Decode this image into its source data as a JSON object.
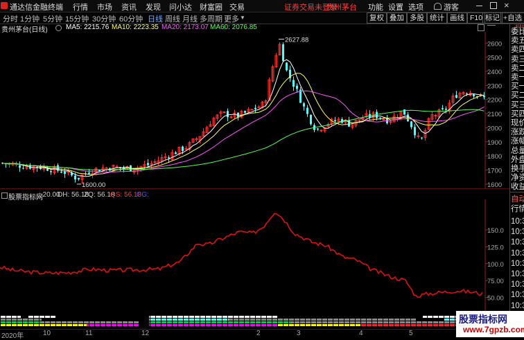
{
  "titlebar": {
    "app_name": "通达信金融终端",
    "menus": [
      "行情",
      "市场",
      "资讯",
      "发现",
      "问小达",
      "财富圈",
      "交易"
    ],
    "notice": "证券交易未登录",
    "stock_tab": "贵州茅台",
    "right_menus": [
      "功能",
      "设置",
      "选项"
    ],
    "user": "游客",
    "window_controls": [
      "minimize-icon",
      "maximize-icon",
      "close-icon"
    ]
  },
  "toolbar": {
    "periods": [
      "分时",
      "1分钟",
      "5分钟",
      "15分钟",
      "30分钟",
      "60分钟",
      "日线",
      "周线",
      "月线",
      "多周期",
      "更多"
    ],
    "selected_period": "日线",
    "buttons": [
      "复权",
      "叠加",
      "多股",
      "统计",
      "画线",
      "F10",
      "标记",
      "+自选"
    ]
  },
  "main_chart": {
    "stock_label": "贵州茅台(日线)",
    "ma": [
      {
        "label": "MA5: 2215.76",
        "color": "#ffffff"
      },
      {
        "label": "MA10: 2223.35",
        "color": "#ffff55"
      },
      {
        "label": "MA20: 2173.07",
        "color": "#ff55ff"
      },
      {
        "label": "MA60: 2076.85",
        "color": "#55ff55"
      }
    ],
    "high_label": "2627.88",
    "low_label": "1600.00",
    "y_ticks": [
      "2600",
      "2500",
      "2400",
      "2300",
      "2200",
      "2100",
      "2000",
      "1900",
      "1800",
      "1700",
      "1600"
    ]
  },
  "indicator": {
    "name": "股票指标网",
    "params": [
      {
        "label": ": 20.00",
        "color": "#cccccc"
      },
      {
        "label": "DH: 56.18",
        "color": "#cccccc"
      },
      {
        "label": "ZQ: 56.18",
        "color": "#cccccc"
      },
      {
        "label": "QS: 56.18",
        "color": "#ff3333"
      },
      {
        "label": "CG:",
        "color": "#5555ff"
      }
    ],
    "y_ticks": [
      "150.0",
      "125.0",
      "100.0",
      "75.00",
      "50.00"
    ]
  },
  "date_axis": [
    "2020年",
    "10",
    "11",
    "12",
    "2",
    "3",
    "4",
    "5"
  ],
  "right_panel": {
    "quote_labels": [
      "委比",
      "卖五",
      "卖四",
      "卖三",
      "卖二",
      "卖一",
      "买一",
      "买二",
      "买三",
      "买四",
      "现价",
      "涨跌",
      "涨幅",
      "总量",
      "外盘",
      "换手",
      "净资",
      "收益"
    ],
    "lower_labels": [
      "自动",
      "行情"
    ],
    "times": [
      "10:3",
      "10:3",
      "10:3",
      "10:3",
      "10:3",
      "10:3",
      "10:3",
      "10:3",
      "10:3",
      "10:3"
    ],
    "corner_value": "300"
  },
  "watermark": {
    "line1": "股票指标网",
    "line2": "www.7gpzb.com"
  },
  "colors": {
    "up": "#ff3232",
    "down": "#54fcfc",
    "qs_line": "#e01010"
  }
}
